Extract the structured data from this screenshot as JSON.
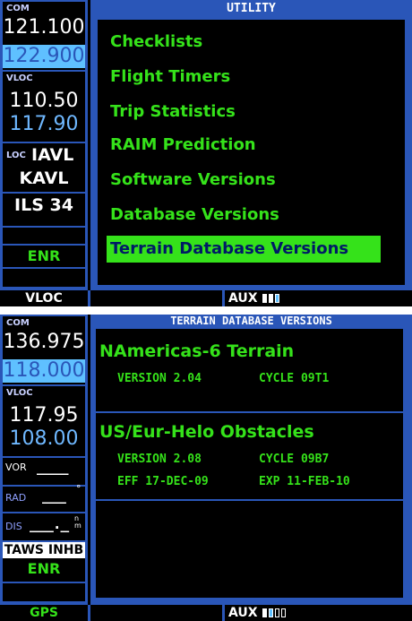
{
  "screen1": {
    "com": {
      "tag": "COM",
      "active": "121.100",
      "standby": "122.900"
    },
    "vloc": {
      "tag": "VLOC",
      "active": "110.50",
      "standby": "117.90"
    },
    "cdi": {
      "tag": "LOC",
      "ident": "IAVL",
      "airport": "KAVL",
      "approach": "ILS 34"
    },
    "mode": "ENR",
    "panel_title": "UTILITY",
    "menu": [
      "Checklists",
      "Flight Timers",
      "Trip Statistics",
      "RAIM Prediction",
      "Software Versions",
      "Database Versions",
      "Terrain Database Versions"
    ],
    "selected_index": 6,
    "bottom": {
      "left": "VLOC",
      "page_group": "AUX"
    }
  },
  "screen2": {
    "com": {
      "tag": "COM",
      "active": "136.975",
      "standby": "118.000"
    },
    "vloc": {
      "tag": "VLOC",
      "active": "117.95",
      "standby": "108.00"
    },
    "cdi": {
      "vor": "VOR",
      "vor_value": "____",
      "rad": "RAD",
      "rad_value": "___",
      "rad_unit": "°",
      "dis": "DIS",
      "dis_value": "___._",
      "dis_unit": "n m"
    },
    "taws": "TAWS INHB",
    "mode": "ENR",
    "panel_title": "TERRAIN DATABASE VERSIONS",
    "databases": [
      {
        "name": "NAmericas-6 Terrain",
        "version": "VERSION 2.04",
        "cycle": "CYCLE 09T1"
      },
      {
        "name": "US/Eur-Helo Obstacles",
        "version": "VERSION 2.08",
        "cycle": "CYCLE 09B7",
        "eff": "EFF 17-DEC-09",
        "exp": "EXP 11-FEB-10"
      }
    ],
    "bottom": {
      "left": "GPS",
      "page_group": "AUX"
    }
  },
  "colors": {
    "frame_blue": "#2a56b8",
    "green": "#35e21a",
    "standby_cyan": "#6fb8ff"
  }
}
